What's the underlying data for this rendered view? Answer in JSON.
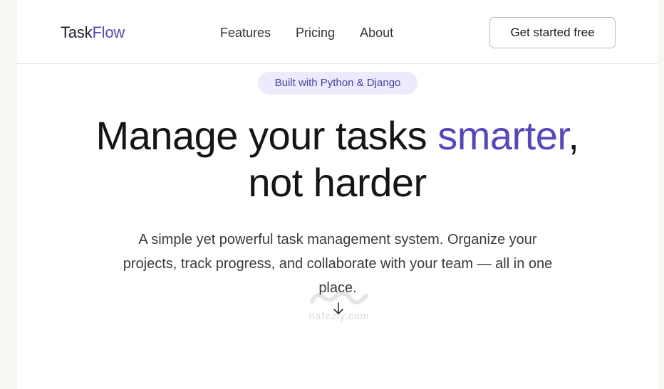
{
  "navbar": {
    "brand_prefix": "Task",
    "brand_suffix": "Flow",
    "links": [
      "Features",
      "Pricing",
      "About"
    ],
    "cta_label": "Get started free"
  },
  "hero": {
    "badge": "Built with Python & Django",
    "headline_part1": "Manage your tasks ",
    "headline_accent": "smarter",
    "headline_part2": ",",
    "headline_line2": "not harder",
    "subtitle": "A simple yet powerful task management system. Organize your projects, track progress, and collaborate with your team — all in one place.",
    "scroll_icon": "arrow-down-icon"
  },
  "watermark": {
    "text": "nafezly.com"
  },
  "colors": {
    "accent": "#5548b8",
    "badge_bg": "#ecebfb",
    "text": "#151515",
    "border": "#e4e4e4"
  }
}
